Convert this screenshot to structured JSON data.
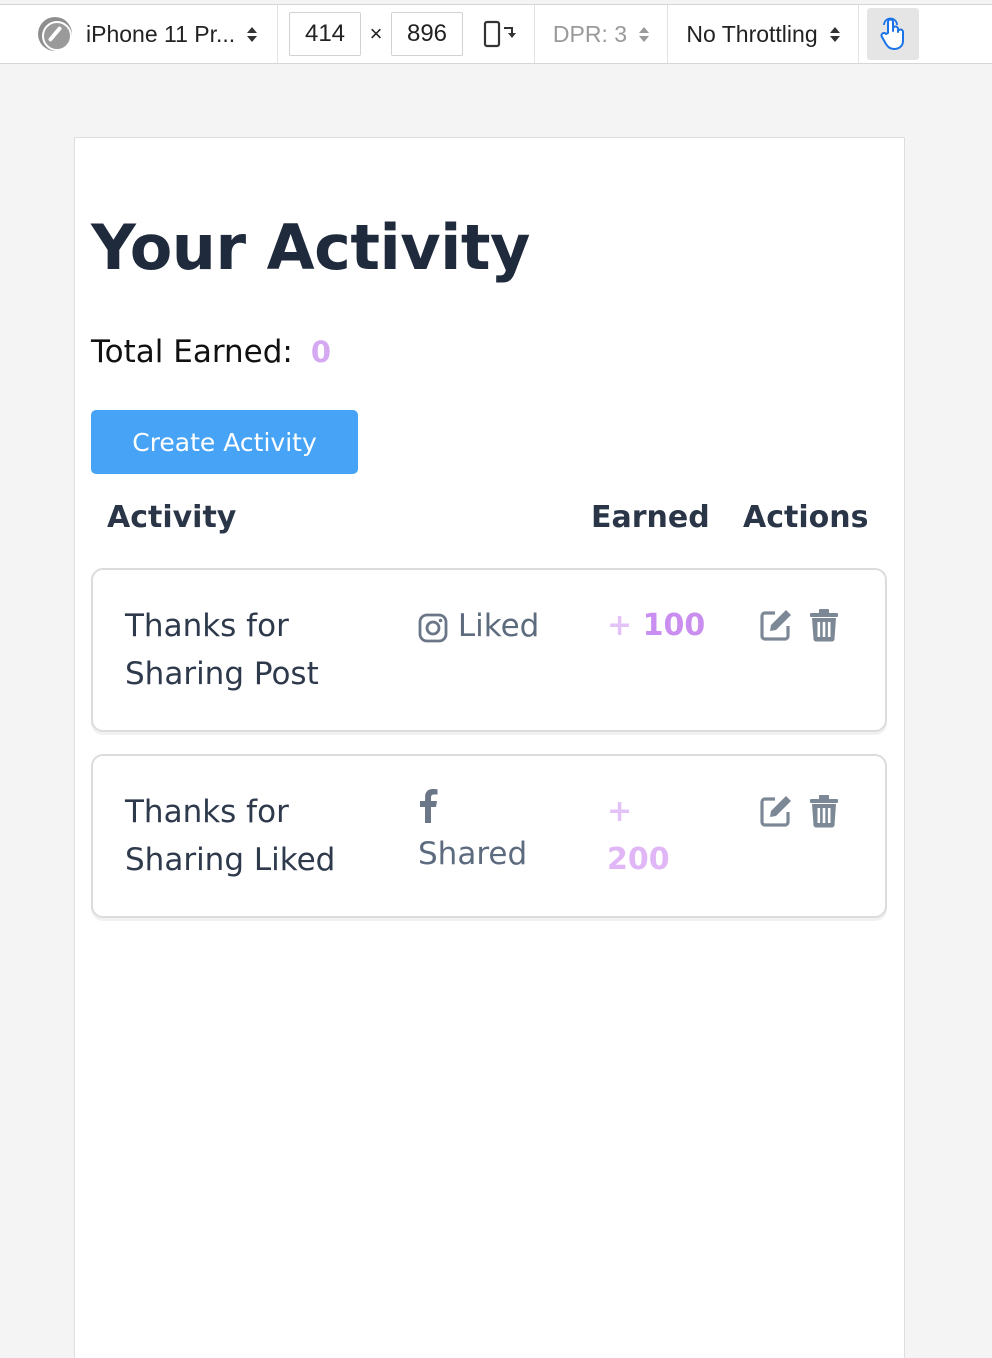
{
  "toolbar": {
    "device": "iPhone 11 Pr...",
    "width": "414",
    "times": "×",
    "height": "896",
    "dpr": "DPR: 3",
    "throttling": "No Throttling"
  },
  "page": {
    "title": "Your Activity",
    "total_label": "Total Earned:",
    "total_value": "0",
    "create_button": "Create Activity",
    "columns": {
      "activity": "Activity",
      "earned": "Earned",
      "actions": "Actions"
    },
    "activities": [
      {
        "title": "Thanks for Sharing Post",
        "platform_icon": "instagram-icon",
        "action": "Liked",
        "earned_prefix": "+",
        "earned": "100"
      },
      {
        "title": "Thanks for Sharing Liked",
        "platform_icon": "facebook-icon",
        "action": "Shared",
        "earned_prefix": "+",
        "earned": "200"
      }
    ]
  },
  "colors": {
    "primary_button": "#47a3f6",
    "earned_accent": "#c98ef0",
    "heading": "#1f2a3c",
    "icon_grey": "#7d8897"
  }
}
